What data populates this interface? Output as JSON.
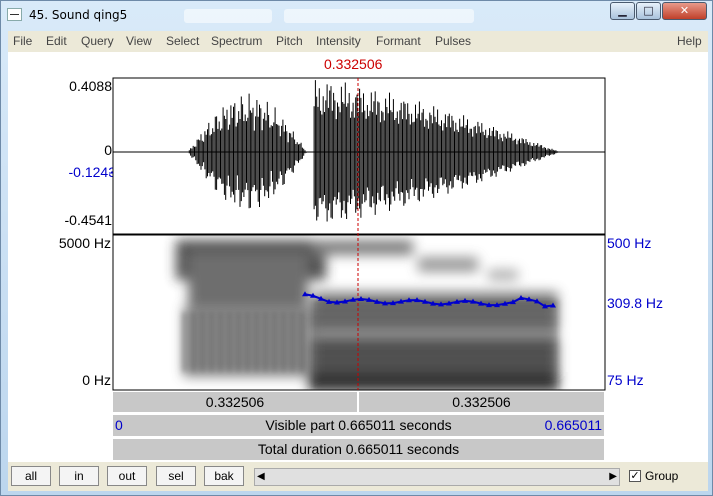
{
  "window": {
    "title": "45. Sound qing5"
  },
  "menu": {
    "items": [
      "File",
      "Edit",
      "Query",
      "View",
      "Select",
      "Spectrum",
      "Pitch",
      "Intensity",
      "Formant",
      "Pulses"
    ],
    "help": "Help"
  },
  "cursor": {
    "time_label": "0.332506"
  },
  "waveform": {
    "y_top": "0.4088",
    "y_zero": "0",
    "y_cursor": "-0.1243",
    "y_bottom": "-0.4541"
  },
  "spectrogram": {
    "freq_top": "5000 Hz",
    "freq_bottom": "0 Hz",
    "pitch_top": "500 Hz",
    "pitch_cursor": "309.8 Hz",
    "pitch_bottom": "75 Hz",
    "pitch_color": "#0000cc"
  },
  "timebar": {
    "left_segment": "0.332506",
    "right_segment": "0.332506",
    "visible_start": "0",
    "visible_label": "Visible part 0.665011 seconds",
    "visible_end": "0.665011",
    "total_label": "Total duration 0.665011 seconds"
  },
  "buttons": {
    "all": "all",
    "in": "in",
    "out": "out",
    "sel": "sel",
    "bak": "bak"
  },
  "group": {
    "label": "Group",
    "checked": true
  }
}
